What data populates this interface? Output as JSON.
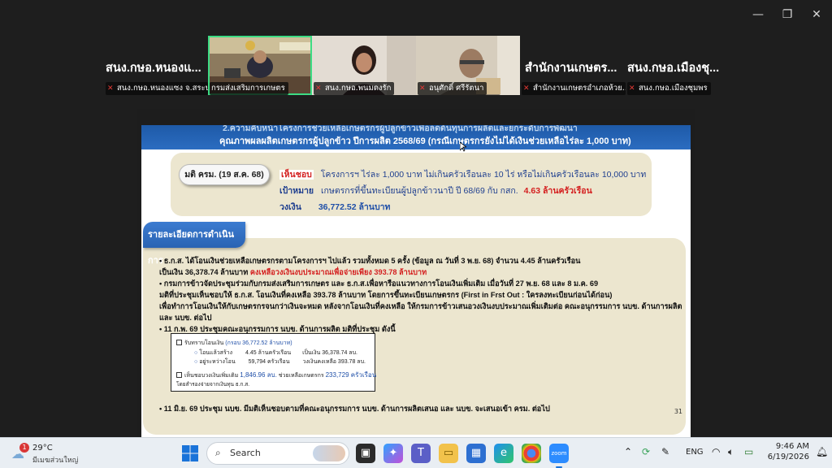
{
  "window": {
    "minimize_glyph": "—",
    "restore_glyph": "❐",
    "close_glyph": "✕"
  },
  "participants": {
    "names": [
      "สนง.กษอ.หนองแ...",
      "สำนักงานเกษตร...",
      "สนง.กษอ.เมืองชุ..."
    ],
    "labels": [
      "สนง.กษอ.หนองแซง จ.สระบุรี",
      "กรมส่งเสริมการเกษตร",
      "สนง.กษอ.พนมดงรัก",
      "อนุศักดิ์ ศรีรัตนา",
      "สำนักงานเกษตรอำเภอห้วย...",
      "สนง.กษอ.เมืองชุมพร"
    ],
    "active_color": "#3ddc84",
    "mute_color": "#e53935"
  },
  "slide": {
    "header_line1": "2.ความคืบหน้าโครงการช่วยเหลือเกษตรกรผู้ปลูกข้าวเพื่อลดต้นทุนการผลิตและยกระดับการพัฒนา",
    "header_line2": "คุณภาพผลผลิตเกษตรกรผู้ปลูกข้าว ปีการผลิต 2568/69 (กรณีเกษตรกรยังไม่ได้เงินช่วยเหลือไร่ละ 1,000 บาท)",
    "cabinet": {
      "pill": "มติ ครม. (19 ส.ค. 68)",
      "approve_key": "เห็นชอบ",
      "approve_text": "โครงการฯ ไร่ละ 1,000 บาท ไม่เกินครัวเรือนละ 10 ไร่ หรือไม่เกินครัวเรือนละ 10,000 บาท",
      "target_key": "เป้าหมาย",
      "target_text": "เกษตรกรที่ขึ้นทะเบียนผู้ปลูกข้าวนาปี ปี 68/69 กับ กสก.",
      "target_value": "4.63 ล้านครัวเรือน",
      "budget_key": "วงเงิน",
      "budget_value": "36,772.52 ล้านบาท"
    },
    "detail_tab": "รายละเอียดการดำเนินการ",
    "details": {
      "l1": "• ธ.ก.ส. ได้โอนเงินช่วยเหลือเกษตรกรตามโครงการฯ ไปแล้ว รวมทั้งหมด 5 ครั้ง (ข้อมูล ณ วันที่ 3 พ.ย. 68) จำนวน 4.45 ล้านครัวเรือน",
      "l2a": "เป็นเงิน 36,378.74 ล้านบาท",
      "l2b": "คงเหลือวงเงินงบประมาณเพื่อจ่ายเพียง 393.78 ล้านบาท",
      "l3": "• กรมการข้าวจัดประชุมร่วมกับกรมส่งเสริมการเกษตร และ ธ.ก.ส.เพื่อหารือแนวทางการโอนเงินเพิ่มเติม เมื่อวันที่ 27 พ.ย. 68 และ 8 ม.ค. 69",
      "l4": "มติที่ประชุมเห็นชอบให้ ธ.ก.ส. โอนเงินที่คงเหลือ 393.78 ล้านบาท โดยการขึ้นทะเบียนเกษตรกร (First in Frst Out : ใครลงทะเบียนก่อนได้ก่อน)",
      "l5": "เพื่อทำการโอนเงินให้กับเกษตรกรจนกว่าเงินจะหมด หลังจากโอนเงินที่คงเหลือ ให้กรมการข้าวเสนอวงเงินงบประมาณเพิ่มเติมต่อ คณะอนุกรรมการ นบข. ด้านการผลิต",
      "l6": "และ นบข. ต่อไป",
      "l7": "• 11 ก.พ. 69 ประชุมคณะอนุกรรมการ นบข. ด้านการผลิต มติที่ประชุม ดังนี้",
      "l8": "• 11 มิ.ย. 69 ประชุม นบข. มีมติเห็นชอบตามที่คณะอนุกรรมการ นบข. ด้านการผลิตเสนอ และ นบข. จะเสนอเข้า ครม. ต่อไป"
    },
    "inset": {
      "ack_label": "รับทราบโอนเงิน",
      "ack_budget": "(กรอบ 36,772.52 ล้านบาท)",
      "row1_label": "โอนแล้วสร้าง",
      "row1_hh": "4.45 ล้านครัวเรือน",
      "row1_amount": "เป็นเงิน 36,378.74 ลบ.",
      "row2_label": "อยู่ระหว่างโอน",
      "row2_hh": "59,794 ครัวเรือน",
      "row2_amount": "วงเงินคงเหลือ 393.78 ลบ.",
      "approve_label": "เห็นชอบวงเงินเพิ่มเติม",
      "approve_amount": "1,846.96 ลบ.",
      "approve_help": "ช่วยเหลือเกษตรกร",
      "approve_hh": "233,729 ครัวเรือน",
      "source": "โดยสำรองจ่ายจากเงินทุน ธ.ก.ส."
    },
    "page_number": "31"
  },
  "taskbar": {
    "weather_temp": "29°C",
    "weather_desc": "มีเมฆส่วนใหญ่",
    "weather_badge": "1",
    "search_placeholder": "Search",
    "language": "ENG",
    "time": "9:46 AM",
    "date": "6/19/2026"
  }
}
